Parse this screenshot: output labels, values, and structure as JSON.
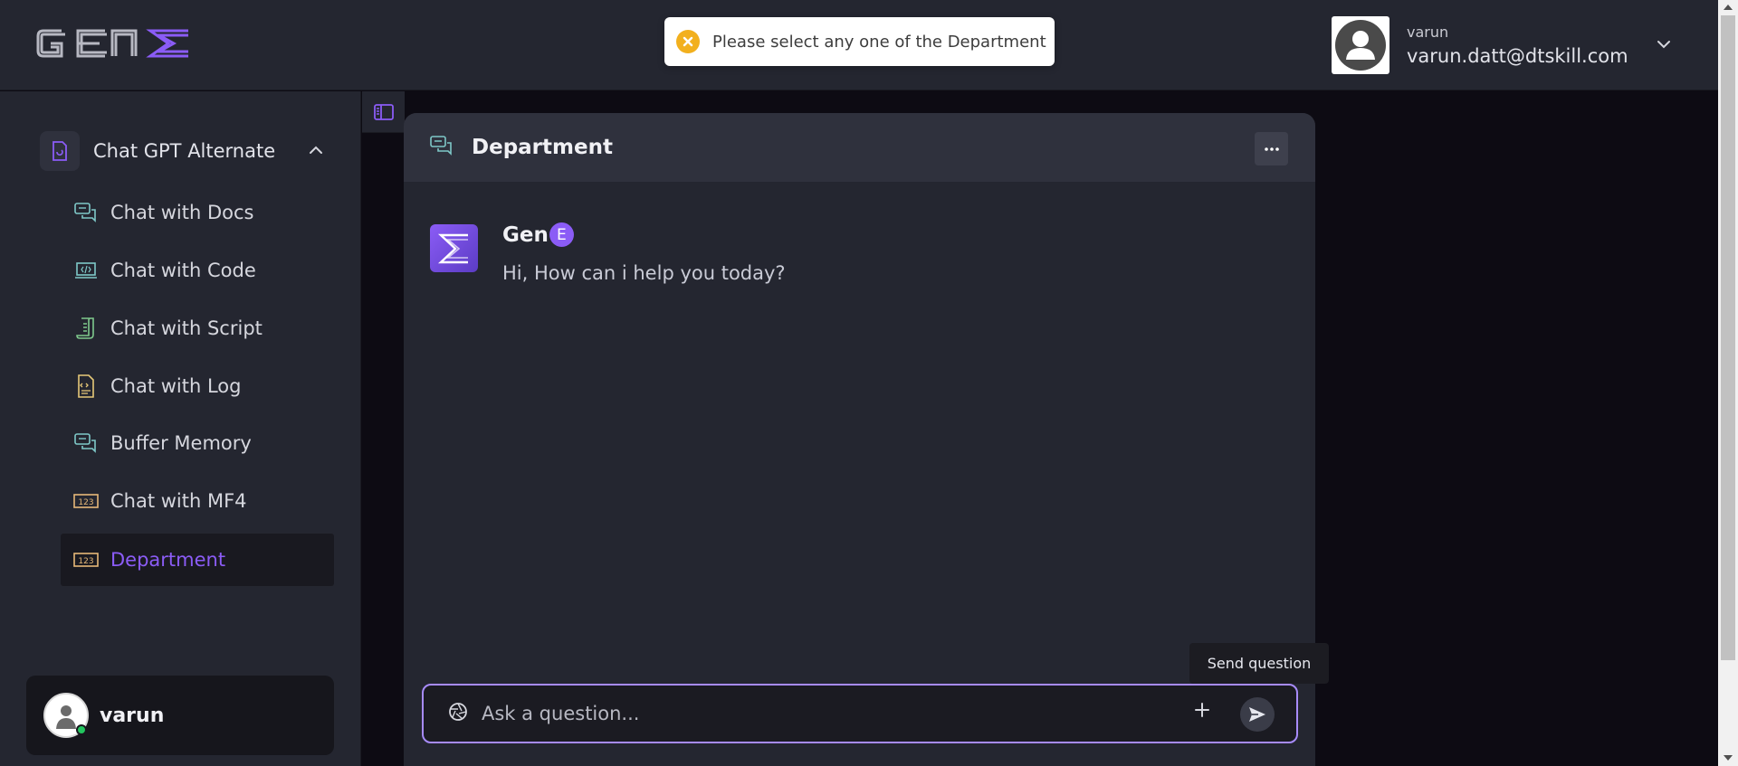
{
  "brand": {
    "logo_text": "GENΣ"
  },
  "toast": {
    "message": "Please select any one of the Department",
    "icon": "close-circle-icon",
    "color": "#f2b01e"
  },
  "profile": {
    "name": "varun",
    "email": "varun.datt@dtskill.com"
  },
  "sidebar": {
    "group": {
      "label": "Chat GPT Alternate",
      "expanded": true
    },
    "items": [
      {
        "label": "Chat with Docs",
        "icon": "chat-bubbles-icon"
      },
      {
        "label": "Chat with Code",
        "icon": "code-laptop-icon"
      },
      {
        "label": "Chat with Script",
        "icon": "script-scroll-icon"
      },
      {
        "label": "Chat with Log",
        "icon": "log-file-icon"
      },
      {
        "label": "Buffer Memory",
        "icon": "chat-bubbles-icon"
      },
      {
        "label": "Chat with MF4",
        "icon": "number-box-icon"
      },
      {
        "label": "Department",
        "icon": "number-box-icon",
        "active": true
      }
    ],
    "user": {
      "name": "varun",
      "status": "online"
    }
  },
  "chat": {
    "title": "Department",
    "bot_name": "Gen",
    "bot_badge": "E",
    "greeting": "Hi, How can i help you today?"
  },
  "composer": {
    "placeholder": "Ask a question...",
    "send_tooltip": "Send question"
  },
  "colors": {
    "accent": "#8b5cf6",
    "panel": "#242630",
    "background": "#0d0b13"
  }
}
